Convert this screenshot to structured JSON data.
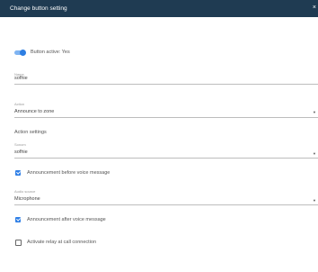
{
  "dialog": {
    "title": "Change button setting",
    "close_glyph": "×"
  },
  "toggle": {
    "label": "Button active: Yes",
    "state": "on",
    "accent_color": "#2d7ee2"
  },
  "fields": {
    "name": {
      "label": "Name",
      "value": "sofhie"
    },
    "action": {
      "label": "Action",
      "value": "Announce to zone"
    }
  },
  "action_settings": {
    "heading": "Action settings",
    "zone": {
      "label": "Sonom",
      "value": "sofhie"
    },
    "announce_before": {
      "label": "Announcement before voice message",
      "checked": true
    },
    "audio_source": {
      "label": "Audio source",
      "value": "Microphone"
    },
    "announce_after": {
      "label": "Announcement after voice message",
      "checked": true
    },
    "relay": {
      "label": "Activate relay at call connection",
      "checked": false
    }
  },
  "icons": {
    "close": "close-icon",
    "dropdown": "chevron-down-icon"
  },
  "colors": {
    "titlebar": "#1f3b52",
    "checkbox": "#2f7fe6"
  }
}
